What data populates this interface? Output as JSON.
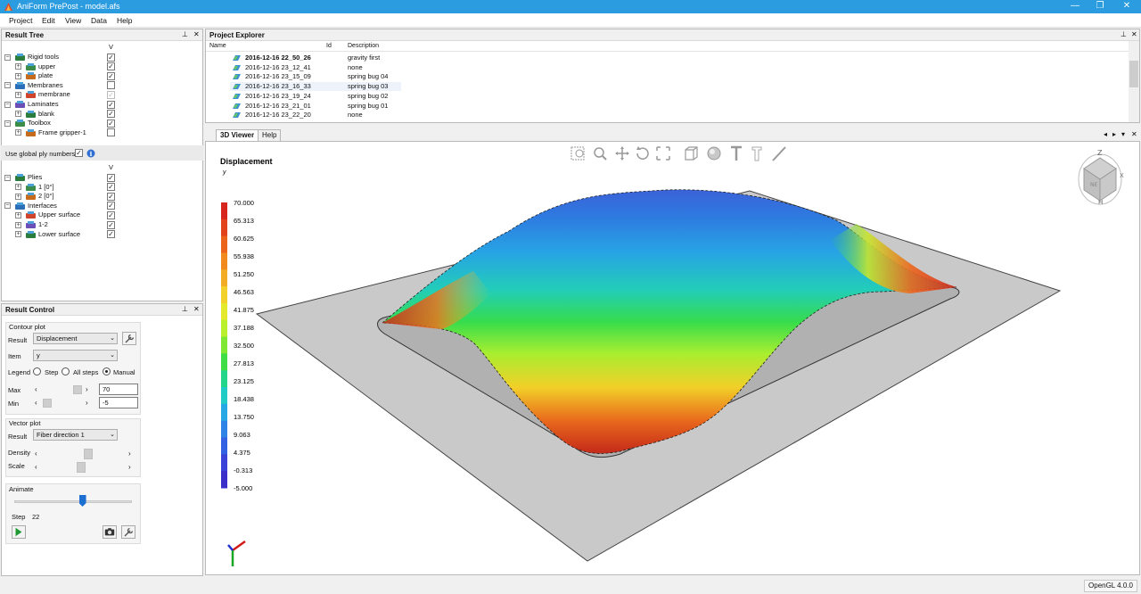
{
  "window": {
    "title": "AniForm PrePost - model.afs",
    "minimize": "—",
    "maximize": "❐",
    "close": "✕"
  },
  "menu": [
    "Project",
    "Edit",
    "View",
    "Data",
    "Help"
  ],
  "result_tree": {
    "title": "Result Tree",
    "pin": "⊥",
    "close": "✕",
    "visibility_header": "V",
    "items": [
      {
        "label": "Rigid tools",
        "level": 0,
        "checked": true
      },
      {
        "label": "upper",
        "level": 1,
        "checked": true
      },
      {
        "label": "plate",
        "level": 1,
        "checked": true
      },
      {
        "label": "Membranes",
        "level": 0,
        "checked": false
      },
      {
        "label": "membrane",
        "level": 1,
        "checked": true,
        "grayed": true
      },
      {
        "label": "Laminates",
        "level": 0,
        "checked": true
      },
      {
        "label": "blank",
        "level": 1,
        "checked": true
      },
      {
        "label": "Toolbox",
        "level": 0,
        "checked": true
      },
      {
        "label": "Frame gripper-1",
        "level": 1,
        "checked": false
      }
    ],
    "global_ply_label": "Use global ply numbers",
    "plies_items": [
      {
        "label": "Plies",
        "level": 0,
        "checked": true
      },
      {
        "label": "1 [0°]",
        "level": 1,
        "checked": true
      },
      {
        "label": "2 [0°]",
        "level": 1,
        "checked": true
      },
      {
        "label": "Interfaces",
        "level": 0,
        "checked": true
      },
      {
        "label": "Upper surface",
        "level": 1,
        "checked": true
      },
      {
        "label": "1-2",
        "level": 1,
        "checked": true
      },
      {
        "label": "Lower surface",
        "level": 1,
        "checked": true
      }
    ]
  },
  "result_control": {
    "title": "Result Control",
    "contour_plot": "Contour plot",
    "result_label": "Result",
    "result_value": "Displacement",
    "item_label": "Item",
    "item_value": "y",
    "legend_label": "Legend",
    "legend_options": [
      "Step",
      "All steps",
      "Manual"
    ],
    "legend_selected": "Manual",
    "max_label": "Max",
    "max_value": "70",
    "min_label": "Min",
    "min_value": "-5",
    "vector_plot": "Vector plot",
    "vector_result_label": "Result",
    "vector_result_value": "Fiber direction 1",
    "density_label": "Density",
    "scale_label": "Scale",
    "animate_label": "Animate",
    "step_label": "Step",
    "step_value": "22",
    "animate_fraction": 0.58
  },
  "project_explorer": {
    "title": "Project Explorer",
    "columns": [
      "Name",
      "Id",
      "Description"
    ],
    "rows": [
      {
        "name": "2016-12-16 22_50_26",
        "id": "",
        "description": "gravity first",
        "bold": true
      },
      {
        "name": "2016-12-16 23_12_41",
        "id": "",
        "description": "none"
      },
      {
        "name": "2016-12-16 23_15_09",
        "id": "",
        "description": "spring bug 04"
      },
      {
        "name": "2016-12-16 23_16_33",
        "id": "",
        "description": "spring bug 03"
      },
      {
        "name": "2016-12-16 23_19_24",
        "id": "",
        "description": "spring bug 02"
      },
      {
        "name": "2016-12-16 23_21_01",
        "id": "",
        "description": "spring bug 01"
      },
      {
        "name": "2016-12-16 23_22_20",
        "id": "",
        "description": "none"
      }
    ]
  },
  "tabs": [
    "3D Viewer",
    "Help"
  ],
  "viewer": {
    "legend_title": "Displacement",
    "legend_subtitle": "y",
    "legend_values": [
      "70.000",
      "65.313",
      "60.625",
      "55.938",
      "51.250",
      "46.563",
      "41.875",
      "37.188",
      "32.500",
      "27.813",
      "23.125",
      "18.438",
      "13.750",
      "9.063",
      "4.375",
      "-0.313",
      "-5.000"
    ],
    "legend_colors": [
      "#d7261e",
      "#e2421c",
      "#ec641c",
      "#f1891f",
      "#f3ad25",
      "#f2d12b",
      "#e4ea2b",
      "#b9ef2d",
      "#7ee832",
      "#3fdd46",
      "#23d68a",
      "#21cbc6",
      "#26a8e4",
      "#2d84e6",
      "#3361e3",
      "#3a42d8",
      "#3a2fc8"
    ],
    "toolbar_icons": [
      "zoom-fit-icon",
      "zoom-icon",
      "pan-icon",
      "rotate-icon",
      "fit-all-icon",
      "box-view-icon",
      "sphere-render-icon",
      "text-tool-icon",
      "text-outline-icon",
      "measure-icon"
    ],
    "cube_labels": [
      "NE",
      "Н",
      "Z"
    ]
  },
  "status": {
    "renderer": "OpenGL 4.0.0"
  }
}
